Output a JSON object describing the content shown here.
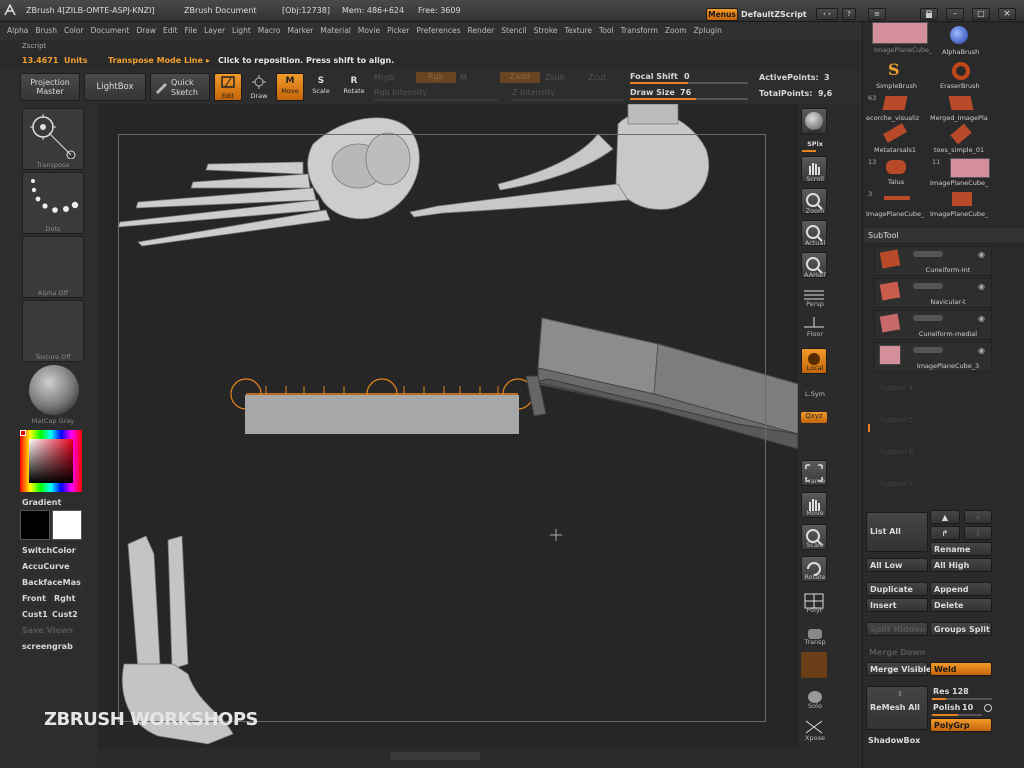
{
  "titlebar": {
    "app": "ZBrush 4[ZILB-OMTE-ASPJ-KNZI]",
    "doc": "ZBrush Document",
    "obj": "[Obj:12738]",
    "mem": "Mem: 486+624",
    "free": "Free: 3609",
    "menus_btn": "Menus",
    "zscript_btn": "DefaultZScript"
  },
  "menubar": {
    "items": [
      "Alpha",
      "Brush",
      "Color",
      "Document",
      "Draw",
      "Edit",
      "File",
      "Layer",
      "Light",
      "Macro",
      "Marker",
      "Material",
      "Movie",
      "Picker",
      "Preferences",
      "Render",
      "Stencil",
      "Stroke",
      "Texture",
      "Tool",
      "Transform",
      "Zoom",
      "Zplugin"
    ],
    "zscript": "Zscript"
  },
  "status": {
    "units_value": "13.4671",
    "units": "Units",
    "mode": "Transpose Mode Line",
    "hint": "Click to reposition. Press shift to align."
  },
  "toolbar": {
    "projection_master": [
      "Projection",
      "Master"
    ],
    "lightbox": "LightBox",
    "quick_sketch": [
      "Quick",
      "Sketch"
    ],
    "edit": "Edit",
    "draw": "Draw",
    "move": "Move",
    "scale": "Scale",
    "rotate": "Rotate",
    "mrgb": "Mrgb",
    "rgb": "Rgb",
    "m": "M",
    "zadd": "Zadd",
    "zsub": "Zsub",
    "zcut": "Zcut",
    "rgb_intensity": "Rgb Intensity",
    "z_intensity": "Z Intensity",
    "focal_shift_label": "Focal Shift",
    "focal_shift_value": "0",
    "draw_size_label": "Draw Size",
    "draw_size_value": "76",
    "active_points_label": "ActivePoints:",
    "active_points_value": "3",
    "total_points_label": "TotalPoints:",
    "total_points_value": "9,6"
  },
  "lefttray": {
    "transpose": "Transpose",
    "dots": "Dots",
    "alpha_off": "Alpha Off",
    "texture_off": "Texture Off",
    "matcap": "MatCap Gray",
    "gradient": "Gradient",
    "switchcolor": "SwitchColor",
    "accucurve": "AccuCurve",
    "backfacemask": "BackfaceMas",
    "front": "Front",
    "rght": "Rght",
    "cust1": "Cust1",
    "cust2": "Cust2",
    "save_views": "Save Views",
    "screengrab": "screengrab",
    "colors": {
      "main": "#000000",
      "secondary": "#ffffff"
    }
  },
  "rightshelf": {
    "bpr": "BPR",
    "spix": "SPix",
    "scroll": "Scroll",
    "zoom": "Zoom",
    "actual": "Actual",
    "aahalf": "AAHalf",
    "persp": "Persp",
    "floor": "Floor",
    "local": "Local",
    "lsym": "L.Sym",
    "qxyz": "Qxyz",
    "frame": "Frame",
    "move": "Move",
    "scale": "Scale",
    "rotate": "Rotate",
    "polyf": "PolyF",
    "transp": "Transp",
    "solo": "Solo",
    "xpose": "Xpose"
  },
  "tools": [
    {
      "label": "ImagePlaneCube_",
      "icon": "pink-plane-icon"
    },
    {
      "label": "AlphaBrush",
      "icon": "alpha-brush-icon"
    },
    {
      "label": "SimpleBrush",
      "icon": "simple-brush-icon"
    },
    {
      "label": "EraserBrush",
      "icon": "eraser-brush-icon"
    },
    {
      "label": "ecorche_visualiz",
      "icon": "bone-icon"
    },
    {
      "label": "Merged_ImagePla",
      "icon": "bone-icon"
    },
    {
      "label": "Metatarsals1",
      "icon": "bone-icon"
    },
    {
      "label": "toes_simple_01",
      "icon": "bone-icon"
    },
    {
      "label": "Talus",
      "icon": "bone-icon"
    },
    {
      "label": "ImagePlaneCube_",
      "icon": "pink-plane-icon"
    },
    {
      "label": "ImagePlaneCube_",
      "icon": "bone-icon"
    },
    {
      "label": "ImagePlaneCube_",
      "icon": "bone-icon"
    }
  ],
  "tool_counts": [
    "63",
    "13",
    "11",
    "3"
  ],
  "subtool": {
    "title": "SubTool",
    "items": [
      "Cuneiform-Int",
      "Navicular-t",
      "Cuneiform-medial",
      "ImagePlaneCube_3"
    ],
    "empty": [
      "Subtool 4",
      "Subtool 5",
      "Subtool 6",
      "Subtool 7"
    ],
    "list_all": "List All",
    "rename": "Rename",
    "all_low": "All Low",
    "all_high": "All High",
    "duplicate": "Duplicate",
    "append": "Append",
    "insert": "Insert",
    "delete": "Delete",
    "split_hidden": "Split Hidden",
    "groups_split": "Groups Split",
    "merge_down": "Merge Down",
    "merge_visible": "Merge Visible",
    "weld": "Weld",
    "remesh_all": "ReMesh All",
    "res_label": "Res",
    "res_value": "128",
    "polish_label": "Polish",
    "polish_value": "10",
    "polygrp": "PolyGrp",
    "shadowbox": "ShadowBox"
  },
  "watermark": "ZBRUSH WORKSHOPS",
  "colors": {
    "accent": "#e8841e",
    "panel": "#2a2a2a",
    "canvas": "#262626"
  }
}
